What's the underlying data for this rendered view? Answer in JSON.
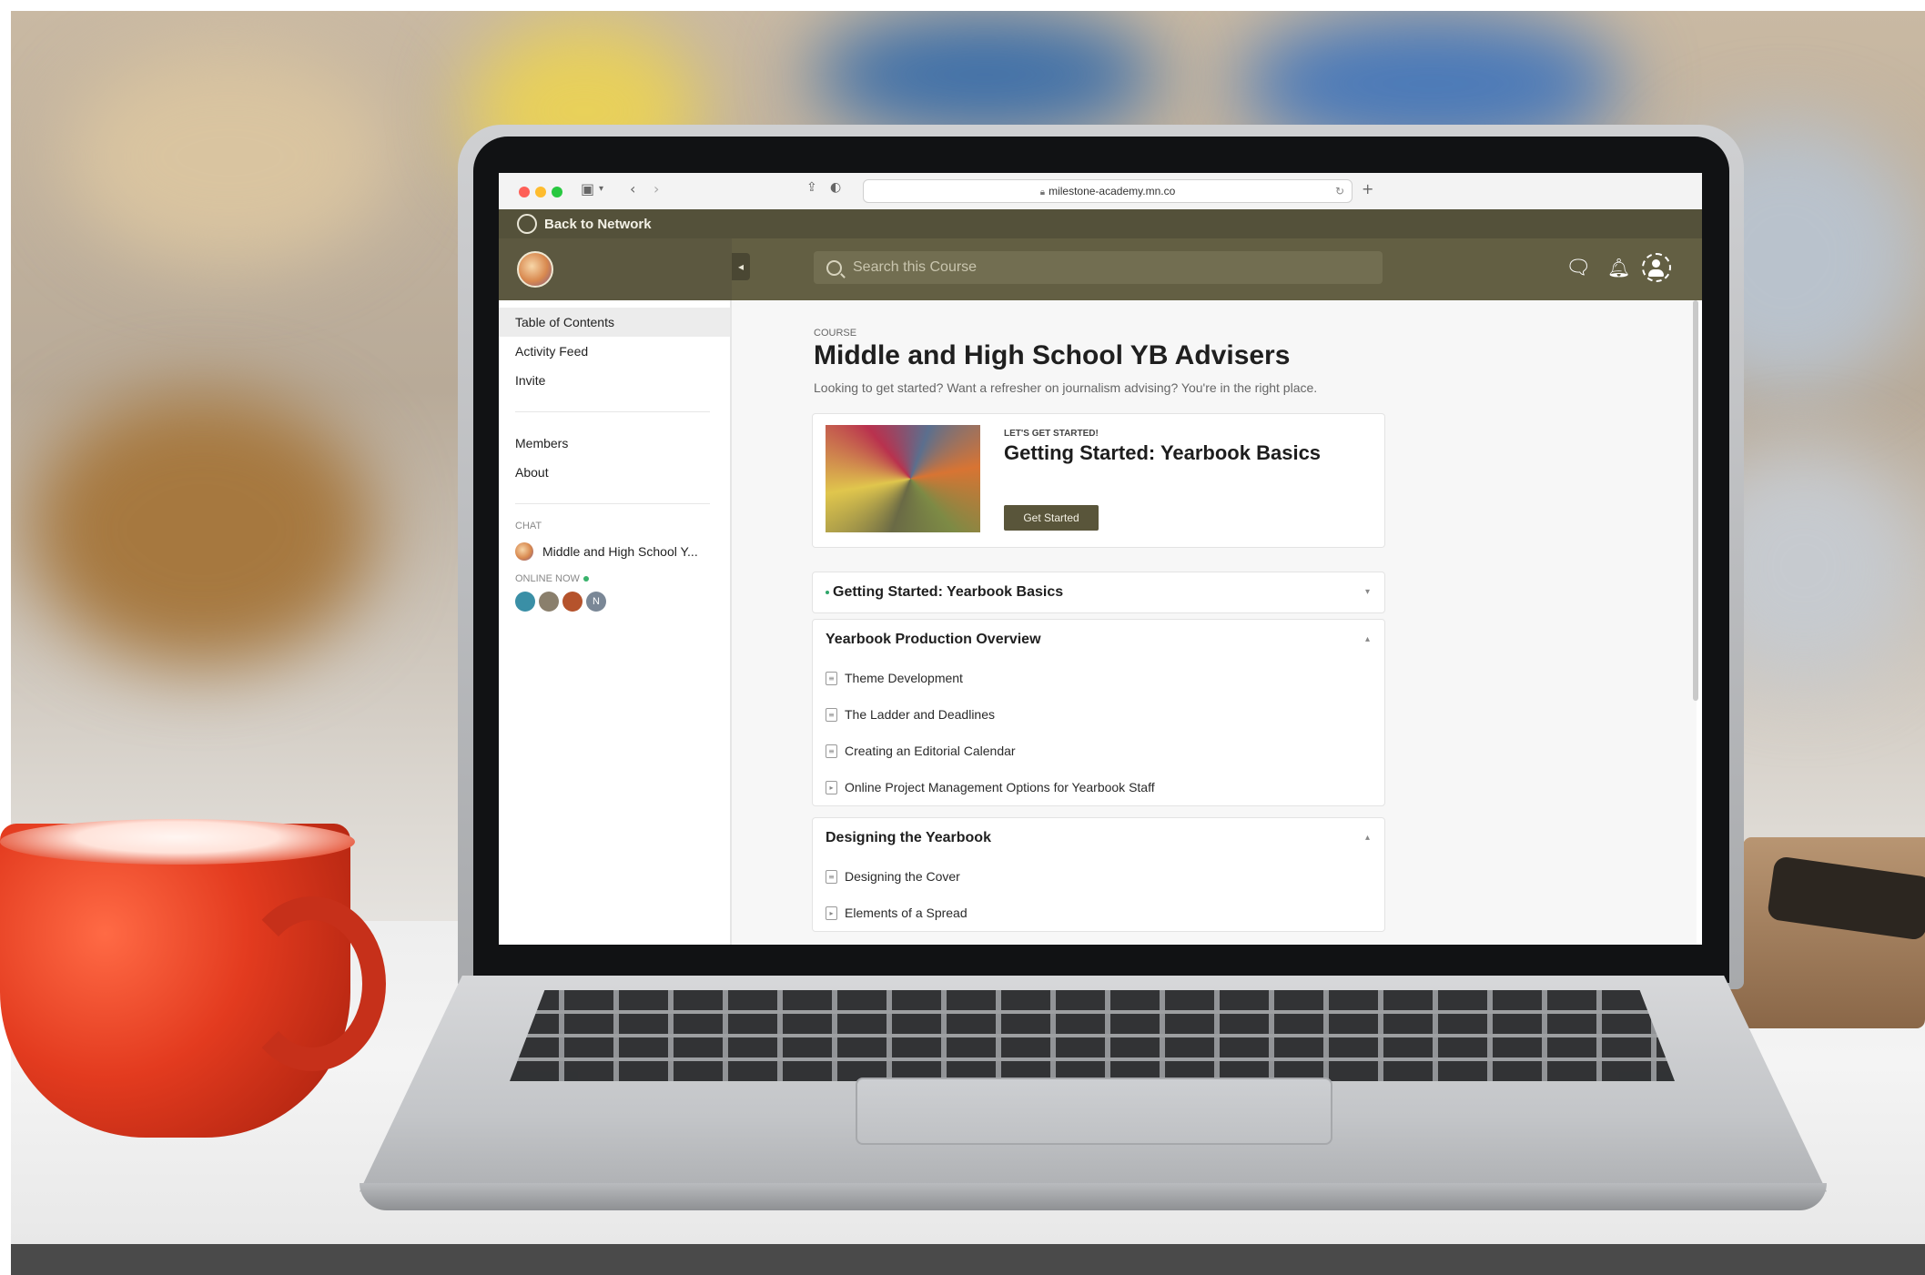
{
  "browser": {
    "url": "milestone-academy.mn.co"
  },
  "network_bar": {
    "back_label": "Back to Network"
  },
  "top_bar": {
    "search_placeholder": "Search this Course"
  },
  "sidebar": {
    "items": [
      {
        "label": "Table of Contents",
        "active": true
      },
      {
        "label": "Activity Feed"
      },
      {
        "label": "Invite"
      }
    ],
    "items2": [
      {
        "label": "Members"
      },
      {
        "label": "About"
      }
    ],
    "chat_label": "CHAT",
    "chat_item": "Middle and High School Y...",
    "online_label": "ONLINE NOW",
    "online_avatars": [
      {
        "initial": "",
        "color": "#3a8fa6"
      },
      {
        "initial": "",
        "color": "#8a7f6c"
      },
      {
        "initial": "",
        "color": "#b5532c"
      },
      {
        "initial": "N",
        "color": "#7a8796"
      }
    ]
  },
  "course": {
    "kicker": "COURSE",
    "title": "Middle and High School YB Advisers",
    "subtitle": "Looking to get started? Want a refresher on journalism advising? You're in the right place."
  },
  "hero": {
    "kicker": "LET'S GET STARTED!",
    "title": "Getting Started: Yearbook Basics",
    "button": "Get Started"
  },
  "sections": [
    {
      "title": "Getting Started: Yearbook Basics",
      "expanded": false,
      "lessons": []
    },
    {
      "title": "Yearbook Production Overview",
      "expanded": true,
      "lessons": [
        {
          "title": "Theme Development",
          "type": "doc"
        },
        {
          "title": "The Ladder and Deadlines",
          "type": "doc"
        },
        {
          "title": "Creating an Editorial Calendar",
          "type": "doc"
        },
        {
          "title": "Online Project Management Options for Yearbook Staff",
          "type": "video"
        }
      ]
    },
    {
      "title": "Designing the Yearbook",
      "expanded": true,
      "lessons": [
        {
          "title": "Designing the Cover",
          "type": "doc"
        },
        {
          "title": "Elements of a Spread",
          "type": "video"
        }
      ]
    }
  ],
  "colors": {
    "brand_dark": "#54513a",
    "brand": "#635f43",
    "online_green": "#38b26b"
  }
}
